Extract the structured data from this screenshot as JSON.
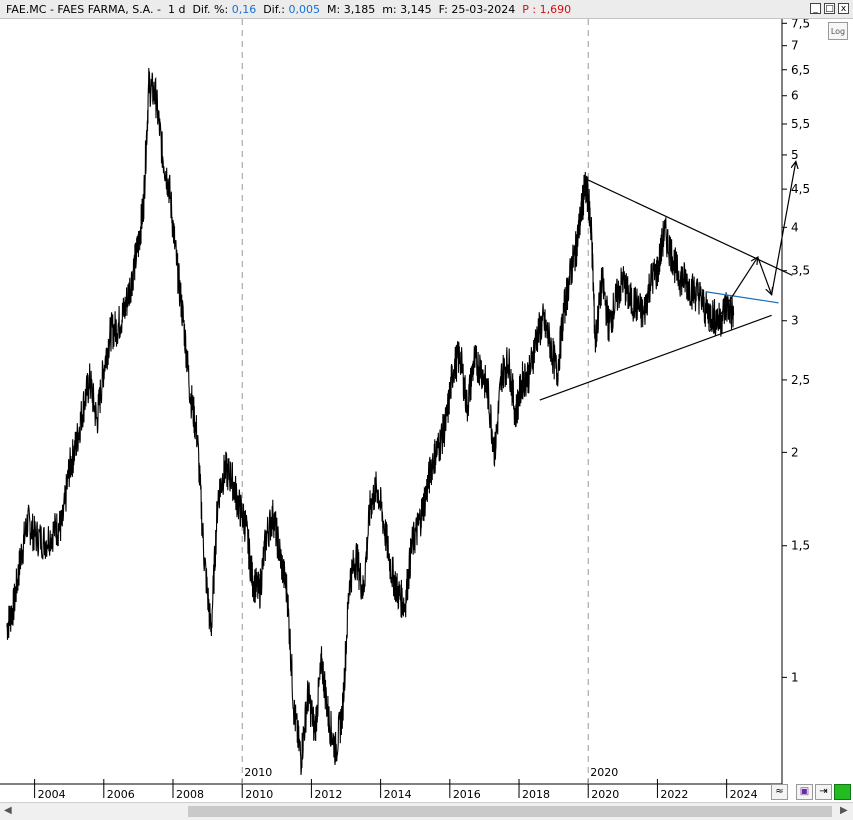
{
  "header": {
    "symbol": "FAE.MC - FAES FARMA, S.A. -",
    "period": "1 d",
    "dif_pct_label": "Dif. %:",
    "dif_pct_value": "0,16",
    "dif_label": "Dif.:",
    "dif_value": "0,005",
    "max_label": "M:",
    "max_value": "3,185",
    "min_label": "m:",
    "min_value": "3,145",
    "date_label": "F:",
    "date_value": "25-03-2024",
    "p_label": "P :",
    "p_value": "1,690"
  },
  "controls": {
    "log_label": "Log",
    "minimize": "_",
    "restore": "□",
    "close": "x"
  },
  "colors": {
    "price": "#000000",
    "trendline": "#000000",
    "blue_trendline": "#1f6fb4",
    "grid_dashed": "#9a9a9a",
    "accent_green": "#22bb22"
  },
  "chart_data": {
    "type": "line",
    "scale": "log",
    "ylim": [
      0.72,
      7.6
    ],
    "xlim": [
      "2003",
      "2025.6"
    ],
    "y_ticks": [
      "7,5",
      "7",
      "6,5",
      "6",
      "5,5",
      "5",
      "4,5",
      "4",
      "3,5",
      "3",
      "2,5",
      "2",
      "1,5",
      "1"
    ],
    "x_ticks": [
      "2004",
      "2006",
      "2008",
      "2010",
      "2012",
      "2014",
      "2016",
      "2018",
      "2020",
      "2022",
      "2024"
    ],
    "x_markers": [
      "2010",
      "2020"
    ],
    "series": [
      {
        "x": [
          2003.2,
          2003.4,
          2003.6,
          2003.8,
          2004.0,
          2004.3,
          2004.6,
          2004.8,
          2005.0,
          2005.2,
          2005.4,
          2005.6,
          2005.8,
          2006.0,
          2006.2,
          2006.4,
          2006.6,
          2006.8,
          2007.0,
          2007.15,
          2007.3,
          2007.5,
          2007.7,
          2007.9,
          2008.1,
          2008.3,
          2008.5,
          2008.7,
          2008.9,
          2009.1,
          2009.3,
          2009.5,
          2009.7,
          2009.9,
          2010.1,
          2010.3,
          2010.5,
          2010.7,
          2010.9,
          2011.1,
          2011.3,
          2011.5,
          2011.7,
          2011.9,
          2012.1,
          2012.3,
          2012.5,
          2012.7,
          2012.9,
          2013.1,
          2013.3,
          2013.5,
          2013.7,
          2013.9,
          2014.1,
          2014.3,
          2014.5,
          2014.7,
          2014.9,
          2015.1,
          2015.3,
          2015.5,
          2015.7,
          2015.9,
          2016.1,
          2016.3,
          2016.5,
          2016.7,
          2016.9,
          2017.1,
          2017.3,
          2017.5,
          2017.7,
          2017.9,
          2018.1,
          2018.3,
          2018.5,
          2018.7,
          2018.9,
          2019.1,
          2019.3,
          2019.5,
          2019.65,
          2019.8,
          2019.9,
          2020.0,
          2020.1,
          2020.2,
          2020.4,
          2020.6,
          2020.8,
          2021.0,
          2021.2,
          2021.4,
          2021.6,
          2021.8,
          2022.0,
          2022.2,
          2022.4,
          2022.6,
          2022.8,
          2023.0,
          2023.2,
          2023.4,
          2023.6,
          2023.8,
          2024.0,
          2024.2
        ],
        "values": [
          1.17,
          1.25,
          1.45,
          1.62,
          1.55,
          1.52,
          1.58,
          1.6,
          1.9,
          2.05,
          2.3,
          2.5,
          2.2,
          2.6,
          2.9,
          2.95,
          3.1,
          3.4,
          3.8,
          4.3,
          6.2,
          6.0,
          5.0,
          4.5,
          3.6,
          3.0,
          2.4,
          2.1,
          1.45,
          1.15,
          1.75,
          1.9,
          1.85,
          1.7,
          1.6,
          1.35,
          1.3,
          1.55,
          1.65,
          1.45,
          1.3,
          0.9,
          0.78,
          0.95,
          0.85,
          1.05,
          0.88,
          0.8,
          0.9,
          1.35,
          1.45,
          1.3,
          1.7,
          1.8,
          1.6,
          1.4,
          1.3,
          1.25,
          1.5,
          1.6,
          1.75,
          1.95,
          2.05,
          2.2,
          2.6,
          2.7,
          2.3,
          2.65,
          2.6,
          2.4,
          2.0,
          2.55,
          2.65,
          2.25,
          2.5,
          2.55,
          2.85,
          3.0,
          2.8,
          2.55,
          3.1,
          3.5,
          3.75,
          4.2,
          4.5,
          4.4,
          3.9,
          2.8,
          3.4,
          2.95,
          3.2,
          3.4,
          3.2,
          3.15,
          3.05,
          3.4,
          3.5,
          3.95,
          3.7,
          3.45,
          3.4,
          3.3,
          3.25,
          3.1,
          3.05,
          3.0,
          3.15,
          3.05
        ]
      }
    ],
    "annotations": [
      {
        "kind": "trendline",
        "from": [
          2018.6,
          2.35
        ],
        "to": [
          2025.3,
          3.05
        ]
      },
      {
        "kind": "trendline",
        "from": [
          2019.9,
          4.65
        ],
        "to": [
          2025.9,
          3.45
        ]
      },
      {
        "kind": "trendline",
        "color": "blue",
        "from": [
          2023.4,
          3.28
        ],
        "to": [
          2025.5,
          3.17
        ]
      },
      {
        "kind": "arrow_path",
        "points": [
          [
            2023.5,
            2.9
          ],
          [
            2024.9,
            3.65
          ],
          [
            2025.3,
            3.25
          ],
          [
            2026.0,
            4.9
          ]
        ]
      }
    ]
  }
}
